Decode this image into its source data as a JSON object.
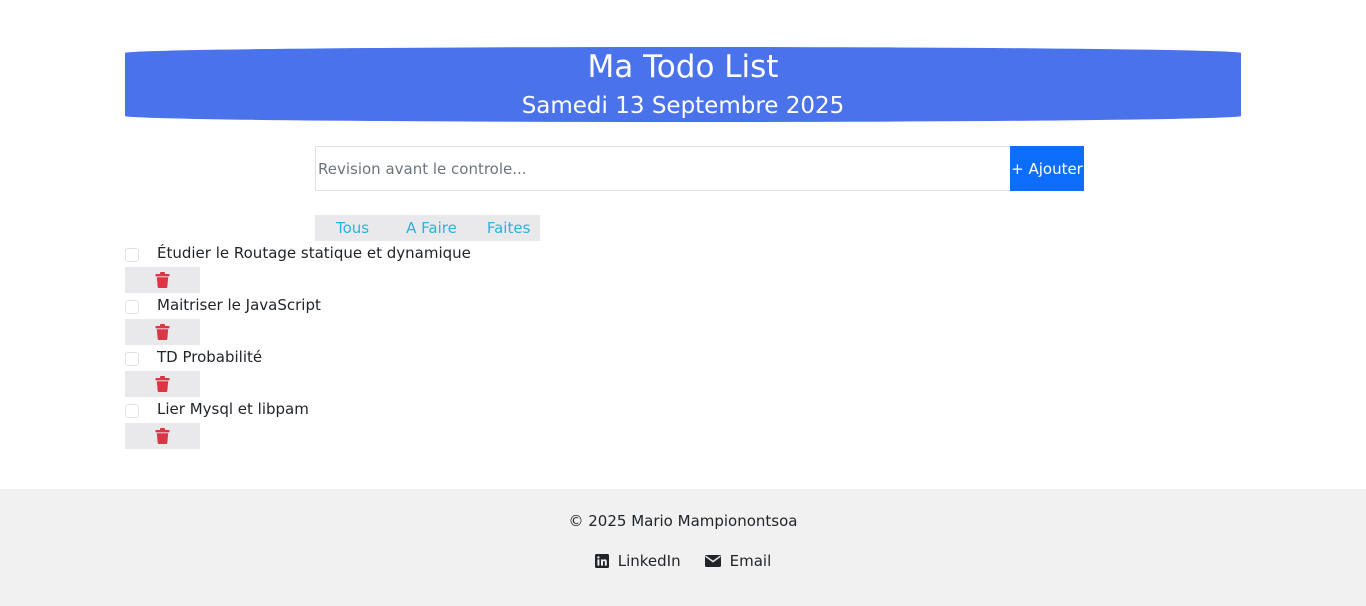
{
  "header": {
    "title": "Ma Todo List",
    "date": "Samedi 13 Septembre 2025",
    "background_color": "#4a72eb"
  },
  "add_form": {
    "input_value": "",
    "input_placeholder": "Revision avant le controle...",
    "button_label": "+ Ajouter",
    "button_color": "#0d6efd"
  },
  "filters": {
    "items": [
      {
        "label": "Tous"
      },
      {
        "label": "A Faire"
      },
      {
        "label": "Faites"
      }
    ],
    "color": "#28b4dc"
  },
  "todos": [
    {
      "label": "Étudier le Routage statique et dynamique",
      "done": false,
      "delete_icon": "trash-icon"
    },
    {
      "label": "Maitriser le JavaScript",
      "done": false,
      "delete_icon": "trash-icon"
    },
    {
      "label": "TD Probabilité",
      "done": false,
      "delete_icon": "trash-icon"
    },
    {
      "label": "Lier Mysql et libpam",
      "done": false,
      "delete_icon": "trash-icon"
    }
  ],
  "delete_color": "#dc3545",
  "footer": {
    "copyright": "© 2025 Mario Mampionontsoa",
    "links": [
      {
        "label": "LinkedIn",
        "icon": "linkedin-icon"
      },
      {
        "label": "Email",
        "icon": "envelope-icon"
      }
    ]
  }
}
